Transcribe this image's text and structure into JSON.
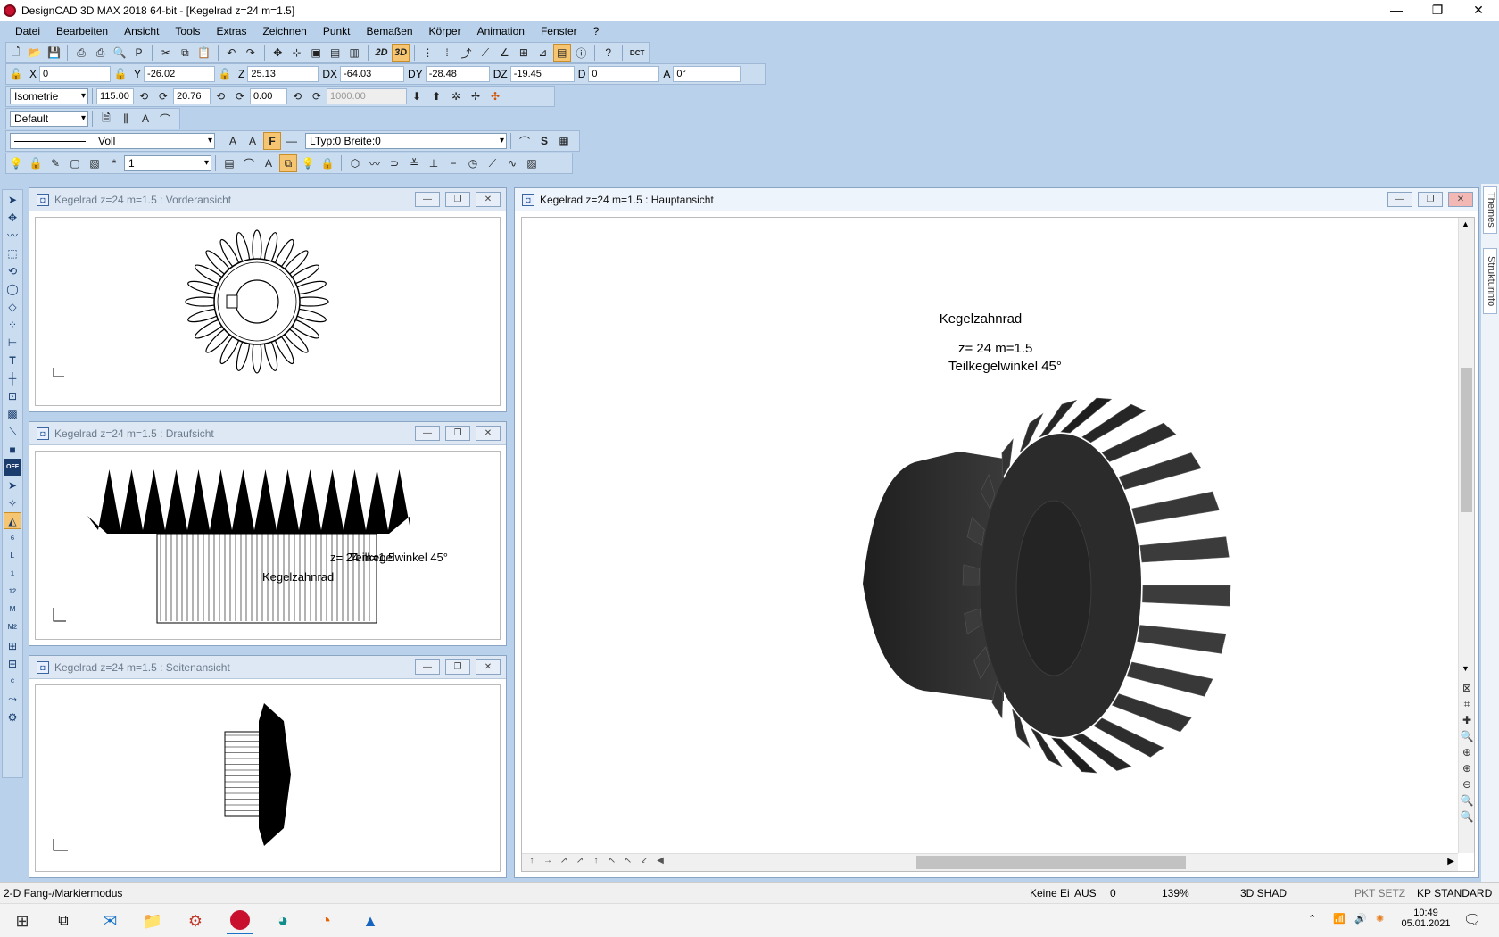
{
  "window": {
    "title": "DesignCAD 3D MAX 2018 64-bit - [Kegelrad  z=24  m=1.5]",
    "minimize": "—",
    "restore": "❐",
    "close": "✕"
  },
  "menu": [
    "Datei",
    "Bearbeiten",
    "Ansicht",
    "Tools",
    "Extras",
    "Zeichnen",
    "Punkt",
    "Bemaßen",
    "Körper",
    "Animation",
    "Fenster",
    "?"
  ],
  "coords": {
    "x_label": "X",
    "x": "0",
    "y_label": "Y",
    "y": "-26.02",
    "z_label": "Z",
    "z": "25.13",
    "dx_label": "DX",
    "dx": "-64.03",
    "dy_label": "DY",
    "dy": "-28.48",
    "dz_label": "DZ",
    "dz": "-19.45",
    "d_label": "D",
    "d": "0",
    "a_label": "A",
    "a": "0°"
  },
  "view_bar": {
    "view_mode": "Isometrie",
    "angle1": "115.00",
    "angle2": "20.76",
    "angle3": "0.00",
    "distance_placeholder": "1000.00"
  },
  "style_bar": {
    "style": "Default"
  },
  "line_bar": {
    "line_type": "Voll",
    "ltyp": "LTyp:0  Breite:0",
    "fill_label": "F"
  },
  "layer_bar": {
    "layer": "1",
    "star": "*"
  },
  "toolbar": {
    "2d": "2D",
    "3d": "3D",
    "dct": "DCT"
  },
  "windows": {
    "front": {
      "title": "Kegelrad  z=24  m=1.5 : Vorderansicht"
    },
    "top": {
      "title": "Kegelrad  z=24  m=1.5 : Draufsicht",
      "label1": "z= 24   m=1.5",
      "label2": "Teilkegelwinkel 45°",
      "label3": "Kegelzahnrad"
    },
    "side": {
      "title": "Kegelrad  z=24  m=1.5 : Seitenansicht"
    },
    "main": {
      "title": "Kegelrad  z=24  m=1.5 : Hauptansicht",
      "heading": "Kegelzahnrad",
      "params": "z= 24   m=1.5",
      "angle": "Teilkegelwinkel 45°"
    }
  },
  "side_tabs": {
    "themes": "Themes",
    "struktur": "Strukturinfo"
  },
  "status": {
    "mode": "2-D Fang-/Markiermodus",
    "keine": "Keine Ei",
    "aus": "AUS",
    "zero": "0",
    "zoom": "139%",
    "shade": "3D SHAD",
    "pkt": "PKT SETZ",
    "kp": "KP STANDARD"
  },
  "clock": {
    "time": "10:49",
    "date": "05.01.2021"
  },
  "colors": {
    "accent": "#b9d1ea",
    "gear": "#2a2a2a",
    "active_tool": "#f6c571"
  }
}
